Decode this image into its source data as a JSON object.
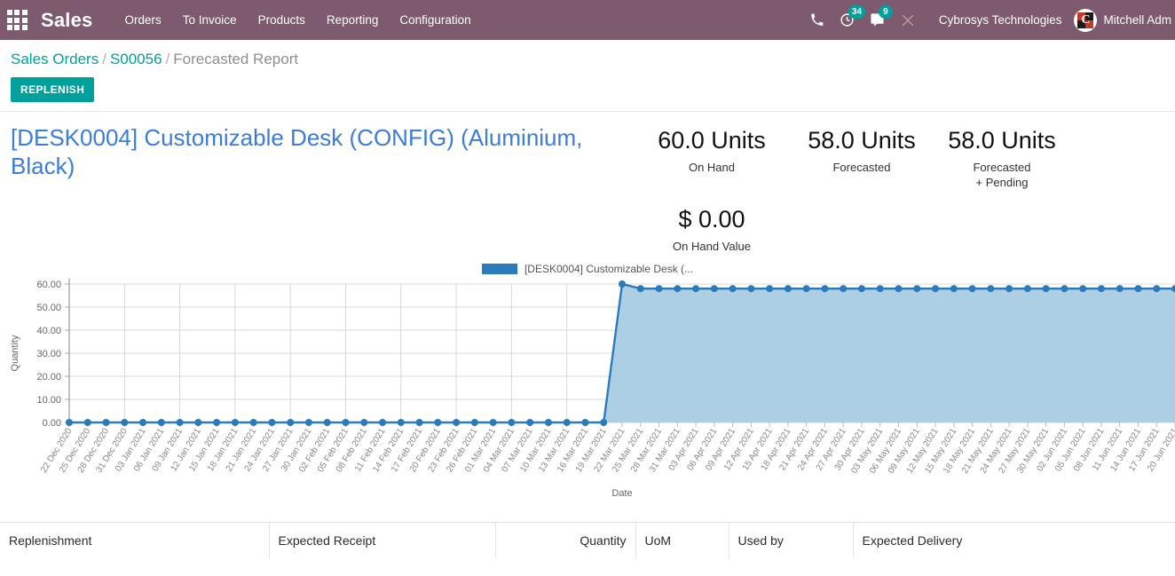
{
  "navbar": {
    "apps_icon": "apps-grid-icon",
    "brand": "Sales",
    "menu": [
      {
        "label": "Orders"
      },
      {
        "label": "To Invoice"
      },
      {
        "label": "Products"
      },
      {
        "label": "Reporting"
      },
      {
        "label": "Configuration"
      }
    ],
    "icons": {
      "phone": "phone-icon",
      "activity": "clock-activity-icon",
      "messages": "chat-bubble-icon",
      "debug": "bug-tools-icon"
    },
    "activity_count": "34",
    "messages_count": "9",
    "company": "Cybrosys Technologies",
    "user_name": "Mitchell Adm",
    "avatar_glyph": "C",
    "background_color": "#7d5a6e",
    "badge_color": "#00a09d"
  },
  "breadcrumb": {
    "root": "Sales Orders",
    "order": "S00056",
    "current": "Forecasted Report",
    "separator": "/"
  },
  "toolbar": {
    "replenish_label": "REPLENISH",
    "replenish_color": "#00a09d"
  },
  "report": {
    "product_title": "[DESK0004] Customizable Desk (CONFIG) (Aluminium, Black)",
    "product_color": "#3b7ddd",
    "stats": [
      {
        "value": "60.0 Units",
        "label": "On Hand"
      },
      {
        "value": "58.0 Units",
        "label": "Forecasted"
      },
      {
        "value": "58.0 Units",
        "label": "Forecasted\n+ Pending"
      }
    ],
    "on_hand_value": {
      "value": "$ 0.00",
      "label": "On Hand Value"
    }
  },
  "chart_data": {
    "type": "area",
    "title": "",
    "xlabel": "Date",
    "ylabel": "Quantity",
    "ylim": [
      0,
      60
    ],
    "yticks": [
      "0.00",
      "10.00",
      "20.00",
      "30.00",
      "40.00",
      "50.00",
      "60.00"
    ],
    "grid": true,
    "legend_position": "top-center",
    "line_color": "#2b7bba",
    "fill_color": "#a9cce3",
    "series": [
      {
        "name": "[DESK0004] Customizable Desk (...",
        "values": [
          0,
          0,
          0,
          0,
          0,
          0,
          0,
          0,
          0,
          0,
          0,
          0,
          0,
          0,
          0,
          0,
          0,
          0,
          0,
          0,
          0,
          0,
          0,
          0,
          0,
          0,
          0,
          0,
          0,
          0,
          60,
          58,
          58,
          58,
          58,
          58,
          58,
          58,
          58,
          58,
          58,
          58,
          58,
          58,
          58,
          58,
          58,
          58,
          58,
          58,
          58,
          58,
          58,
          58,
          58,
          58,
          58,
          58,
          58,
          58,
          58
        ]
      }
    ],
    "categories": [
      "22 Dec 2020",
      "25 Dec 2020",
      "28 Dec 2020",
      "31 Dec 2020",
      "03 Jan 2021",
      "06 Jan 2021",
      "09 Jan 2021",
      "12 Jan 2021",
      "15 Jan 2021",
      "18 Jan 2021",
      "21 Jan 2021",
      "24 Jan 2021",
      "27 Jan 2021",
      "30 Jan 2021",
      "02 Feb 2021",
      "05 Feb 2021",
      "08 Feb 2021",
      "11 Feb 2021",
      "14 Feb 2021",
      "17 Feb 2021",
      "20 Feb 2021",
      "23 Feb 2021",
      "26 Feb 2021",
      "01 Mar 2021",
      "04 Mar 2021",
      "07 Mar 2021",
      "10 Mar 2021",
      "13 Mar 2021",
      "16 Mar 2021",
      "19 Mar 2021",
      "22 Mar 2021",
      "25 Mar 2021",
      "28 Mar 2021",
      "31 Mar 2021",
      "03 Apr 2021",
      "06 Apr 2021",
      "09 Apr 2021",
      "12 Apr 2021",
      "15 Apr 2021",
      "18 Apr 2021",
      "21 Apr 2021",
      "24 Apr 2021",
      "27 Apr 2021",
      "30 Apr 2021",
      "03 May 2021",
      "06 May 2021",
      "09 May 2021",
      "12 May 2021",
      "15 May 2021",
      "18 May 2021",
      "21 May 2021",
      "24 May 2021",
      "27 May 2021",
      "30 May 2021",
      "02 Jun 2021",
      "05 Jun 2021",
      "08 Jun 2021",
      "11 Jun 2021",
      "14 Jun 2021",
      "17 Jun 2021",
      "20 Jun 2021"
    ]
  },
  "table": {
    "columns": [
      {
        "label": "Replenishment",
        "align": "left"
      },
      {
        "label": "Expected Receipt",
        "align": "left"
      },
      {
        "label": "Quantity",
        "align": "right"
      },
      {
        "label": "UoM",
        "align": "left"
      },
      {
        "label": "Used by",
        "align": "left"
      },
      {
        "label": "Expected Delivery",
        "align": "left"
      }
    ]
  }
}
